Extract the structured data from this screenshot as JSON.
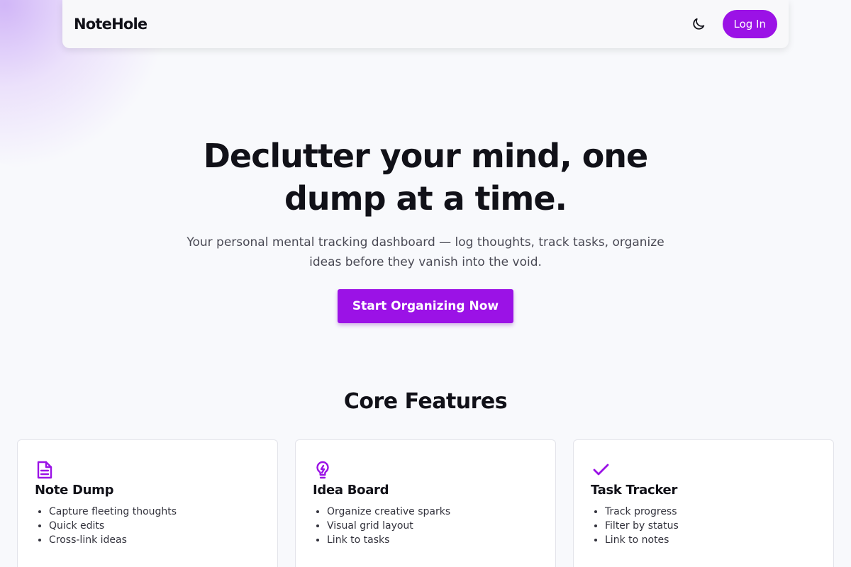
{
  "nav": {
    "brand": "NoteHole",
    "theme_toggle_icon": "moon-icon",
    "login_label": "Log In"
  },
  "hero": {
    "headline": "Declutter your mind, one dump at a time.",
    "subtitle": "Your personal mental tracking dashboard — log thoughts, track tasks, organize ideas before they vanish into the void.",
    "cta_label": "Start Organizing Now"
  },
  "features": {
    "title": "Core Features",
    "cards": [
      {
        "icon": "document-icon",
        "title": "Note Dump",
        "bullets": [
          "Capture fleeting thoughts",
          "Quick edits",
          "Cross-link ideas"
        ]
      },
      {
        "icon": "lightbulb-icon",
        "title": "Idea Board",
        "bullets": [
          "Organize creative sparks",
          "Visual grid layout",
          "Link to tasks"
        ]
      },
      {
        "icon": "check-icon",
        "title": "Task Tracker",
        "bullets": [
          "Track progress",
          "Filter by status",
          "Link to notes"
        ]
      }
    ]
  },
  "colors": {
    "accent": "#9b12e6",
    "background": "#f8f9fc",
    "text": "#111118"
  }
}
